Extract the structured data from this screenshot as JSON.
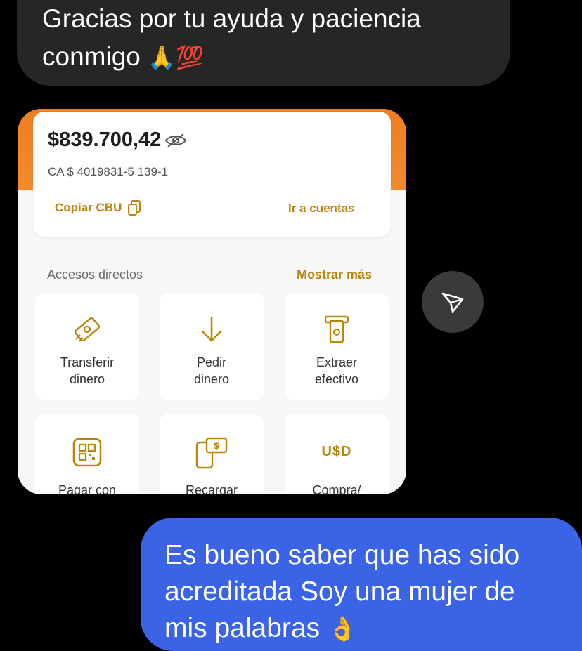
{
  "incoming_message": {
    "line1": "Gracias por tu ayuda y paciencia",
    "line2": "conmigo",
    "emoji": "🙏💯"
  },
  "shared_screenshot": {
    "balance": "$839.700,42",
    "account": "CA $ 4019831-5 139-1",
    "copy_cbu": "Copiar CBU",
    "go_to_accounts": "Ir a cuentas",
    "shortcuts_title": "Accesos directos",
    "show_more": "Mostrar más",
    "tiles": [
      {
        "line1": "Transferir",
        "line2": "dinero",
        "icon": "transfer-money-icon"
      },
      {
        "line1": "Pedir",
        "line2": "dinero",
        "icon": "arrow-down-icon"
      },
      {
        "line1": "Extraer",
        "line2": "efectivo",
        "icon": "atm-cash-icon"
      },
      {
        "line1": "Pagar con",
        "line2": "",
        "icon": "qr-code-icon"
      },
      {
        "line1": "Recargar",
        "line2": "",
        "icon": "phone-recharge-icon"
      },
      {
        "line1": "Compra/",
        "line2": "",
        "icon": "usd-icon",
        "icon_text": "U$D"
      }
    ],
    "accent_color": "#b9860c",
    "band_color": "#f07d22"
  },
  "send_button": {
    "icon": "send-icon"
  },
  "outgoing_message": {
    "line1": "Es bueno saber que has sido",
    "line2": "acreditada Soy una mujer de",
    "line3": "mis palabras",
    "emoji": "👌",
    "bubble_color": "#3a63e6"
  }
}
